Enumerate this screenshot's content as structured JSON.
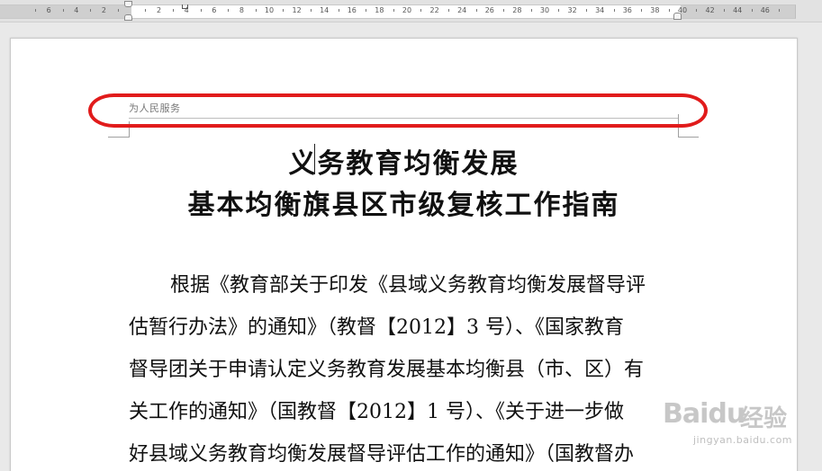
{
  "ruler": {
    "labels": [
      "6",
      "4",
      "2",
      "2",
      "4",
      "6",
      "8",
      "10",
      "12",
      "14",
      "16",
      "18",
      "20",
      "22",
      "24",
      "26",
      "28",
      "30",
      "32",
      "34",
      "36",
      "38",
      "40",
      "42",
      "44",
      "46"
    ]
  },
  "document": {
    "header_text": "为人民服务",
    "title_line_1": "义务教育均衡发展",
    "title_line_2": "基本均衡旗县区市级复核工作指南",
    "body_lines": [
      "根据《教育部关于印发《县域义务教育均衡发展督导评",
      "估暂行办法》的通知》（教督【2012】3 号）、《国家教育",
      "督导团关于申请认定义务教育发展基本均衡县（市、区）有",
      "关工作的通知》（国教督【2012】1 号）、《关于进一步做",
      "好县域义务教育均衡发展督导评估工作的通知》（国教督办"
    ]
  },
  "annotation": {
    "color": "#e11b1b"
  },
  "watermark": {
    "brand": "Baidu",
    "product": "经验",
    "url": "jingyan.baidu.com"
  }
}
